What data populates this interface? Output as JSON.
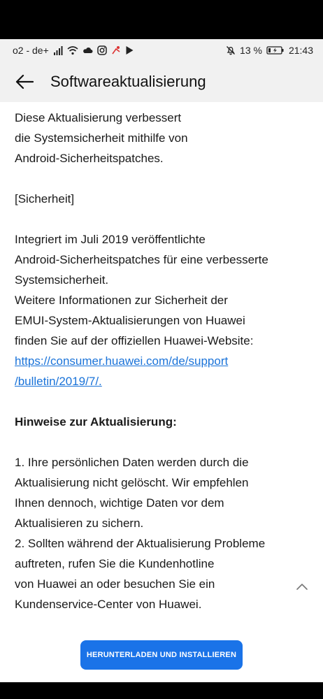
{
  "status_bar": {
    "carrier": "o2 - de+",
    "battery_percent": "13 %",
    "time": "21:43",
    "icons_left": [
      "signal-icon",
      "wifi-icon",
      "cloud-icon",
      "instagram-icon",
      "notification-icon",
      "play-store-icon"
    ],
    "icons_right": [
      "mute-icon",
      "battery-icon"
    ]
  },
  "appbar": {
    "title": "Softwareaktualisierung"
  },
  "content": {
    "intro_lines": [
      "Diese Aktualisierung verbessert",
      "die Systemsicherheit mithilfe von",
      "Android-Sicherheitspatches."
    ],
    "security_heading": "[Sicherheit]",
    "security_lines": [
      "Integriert im Juli 2019 veröffentlichte",
      "Android-Sicherheitspatches für eine verbesserte",
      "Systemsicherheit.",
      "Weitere Informationen zur Sicherheit der",
      "EMUI-System-Aktualisierungen von Huawei",
      "finden Sie auf der offiziellen Huawei-Website:"
    ],
    "link_lines": [
      "https://consumer.huawei.com/de/support",
      "/bulletin/2019/7/."
    ],
    "notes_heading": "Hinweise zur Aktualisierung:",
    "notes_lines": [
      "1. Ihre persönlichen Daten werden durch die",
      "Aktualisierung nicht gelöscht. Wir empfehlen",
      "Ihnen dennoch, wichtige Daten vor dem",
      "Aktualisieren zu sichern.",
      "2. Sollten während der Aktualisierung Probleme",
      "auftreten, rufen Sie die Kundenhotline",
      "von Huawei an oder besuchen Sie ein",
      "Kundenservice-Center von Huawei."
    ]
  },
  "footer": {
    "install_label": "HERUNTERLADEN UND INSTALLIEREN"
  },
  "colors": {
    "accent": "#1a73e8",
    "link": "#1a73d9",
    "bar_background": "#f1f1f1"
  }
}
